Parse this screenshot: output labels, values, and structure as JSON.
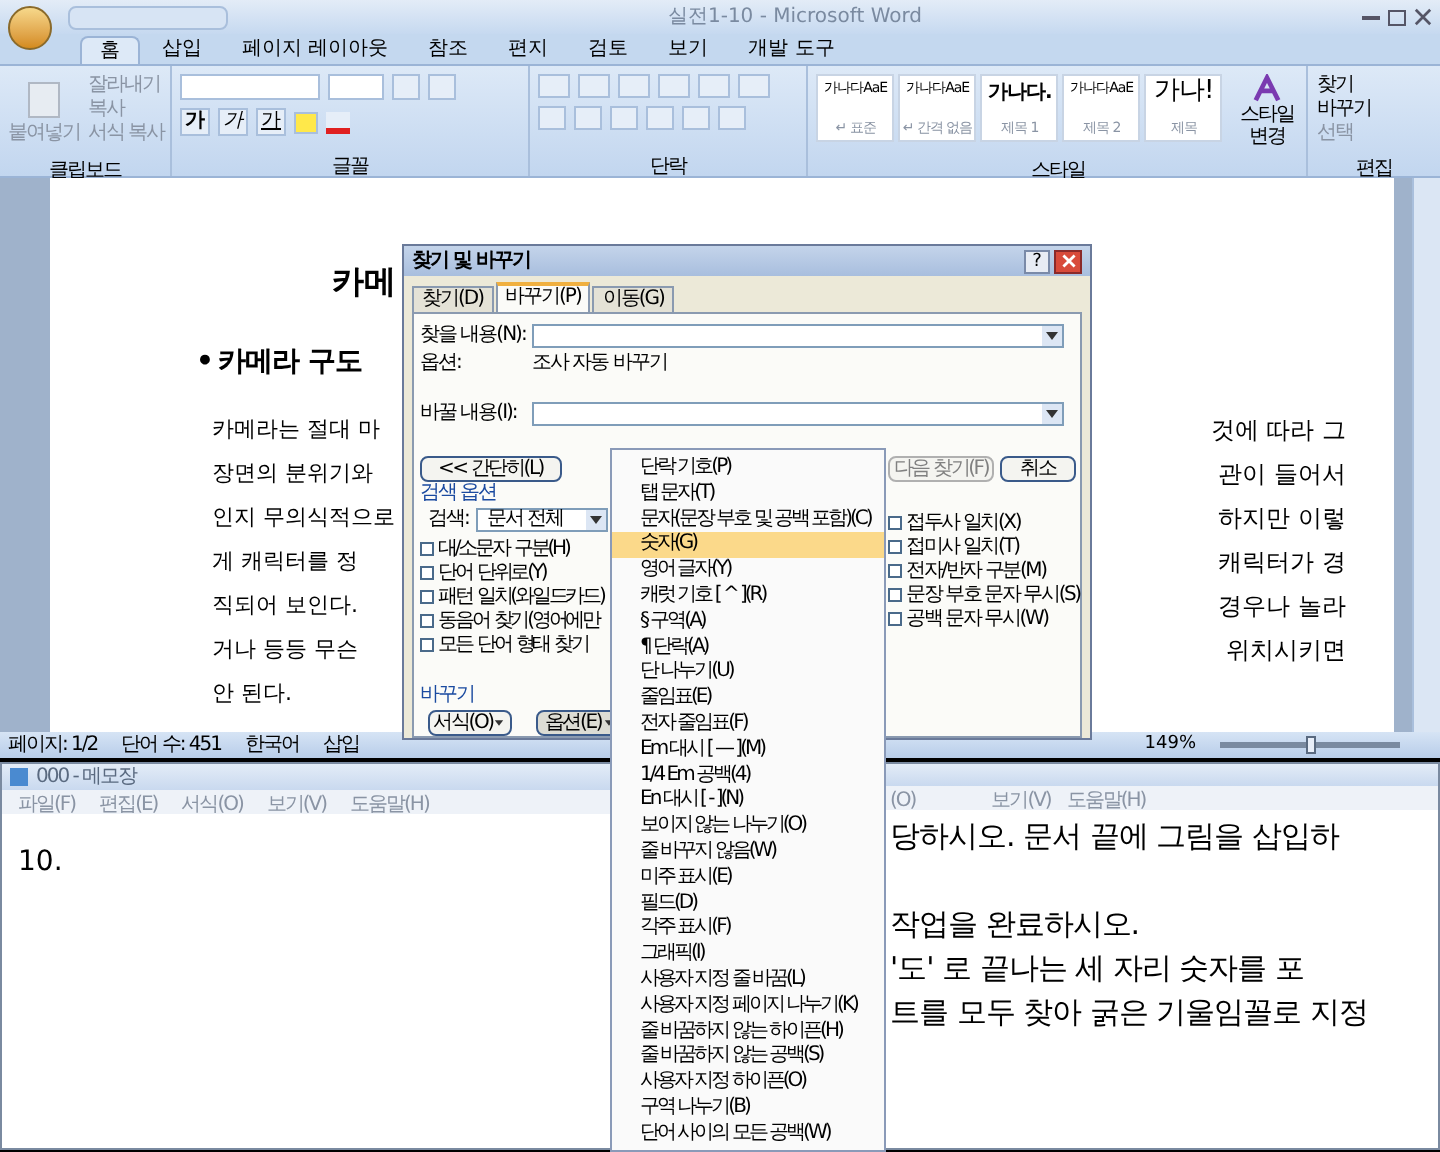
{
  "word": {
    "title": "실전1-10 - Microsoft Word",
    "tabs": [
      {
        "label": "홈",
        "selected": true
      },
      {
        "label": "삽입",
        "selected": false
      },
      {
        "label": "페이지 레이아웃",
        "selected": false
      },
      {
        "label": "참조",
        "selected": false
      },
      {
        "label": "편지",
        "selected": false
      },
      {
        "label": "검토",
        "selected": false
      },
      {
        "label": "보기",
        "selected": false
      },
      {
        "label": "개발 도구",
        "selected": false
      }
    ],
    "ribbon": {
      "clipboard": {
        "label": "클립보드",
        "paste": "붙여넣기",
        "items": [
          "잘라내기",
          "복사",
          "서식 복사"
        ]
      },
      "font": {
        "label": "글꼴",
        "format_buttons": [
          "가",
          "가",
          "가"
        ]
      },
      "paragraph": {
        "label": "단락"
      },
      "styles": {
        "label": "스타일",
        "tiles": [
          {
            "sample": "가나다AaE",
            "name": "↵ 표준",
            "kind": "body"
          },
          {
            "sample": "가나다AaE",
            "name": "↵ 간격 없음",
            "kind": "body"
          },
          {
            "sample": "가나다.",
            "name": "제목 1",
            "kind": "heading"
          },
          {
            "sample": "가나다AaE",
            "name": "제목 2",
            "kind": "body"
          },
          {
            "sample": "가나!",
            "name": "제목",
            "kind": "title"
          }
        ],
        "change": "스타일 변경"
      },
      "editing": {
        "label": "편집",
        "items": [
          "찾기",
          "바꾸기",
          "선택"
        ]
      }
    },
    "document": {
      "title": "카메",
      "bullet": "•",
      "heading": "카메라 구도",
      "lines": [
        {
          "left": "카메라는 절대 마",
          "right": "것에 따라 그"
        },
        {
          "left": "장면의 분위기와",
          "right": "관이 들어서"
        },
        {
          "left": "인지 무의식적으로",
          "right": "하지만 이렇"
        },
        {
          "left": "게 캐릭터를 정",
          "right": "캐릭터가 경"
        },
        {
          "left": "직되어 보인다.",
          "right": "경우나 놀라"
        },
        {
          "left": "거나 등등 무슨",
          "right": "위치시키면"
        },
        {
          "left": "안 된다."
        }
      ]
    },
    "status_bar": {
      "page": "페이지: 1/2",
      "words": "단어 수: 451",
      "language": "한국어",
      "mode": "삽입",
      "zoom": "149%",
      "zoom_slider": {
        "level": 0.5
      }
    }
  },
  "dialog": {
    "title": "찾기 및 바꾸기",
    "help": "?",
    "tabs": [
      {
        "label": "찾기(D)",
        "selected": false
      },
      {
        "label": "바꾸기(P)",
        "selected": true
      },
      {
        "label": "이동(G)",
        "selected": false
      }
    ],
    "find_label": "찾을 내용(N):",
    "options_label": "옵션:",
    "options_value": "조사 자동 바꾸기",
    "replace_label": "바꿀 내용(I):",
    "less_button": "<< 간단히(L)",
    "find_next": "다음 찾기(F)",
    "cancel": "취소",
    "search_options": "검색 옵션",
    "search_label": "검색:",
    "search_value": "문서 전체",
    "left_checks": [
      {
        "label": "대/소문자 구분(H)",
        "checked": false
      },
      {
        "label": "단어 단위로(Y)",
        "checked": false
      },
      {
        "label": "패턴 일치(와일드카드)",
        "checked": false
      },
      {
        "label": "동음어 찾기(영어에만",
        "checked": false
      },
      {
        "label": "모든 단어 형태 찾기",
        "checked": false
      }
    ],
    "right_checks": [
      {
        "label": "접두사 일치(X)",
        "checked": false
      },
      {
        "label": "접미사 일치(T)",
        "checked": false
      },
      {
        "label": "전자/반자 구분(M)",
        "checked": false
      },
      {
        "label": "문장 부호 문자 무시(S)",
        "checked": false
      },
      {
        "label": "공백 문자 무시(W)",
        "checked": false
      }
    ],
    "replace_section": "바꾸기",
    "format_button": "서식(O)",
    "special_button": "옵션(E)"
  },
  "menu": {
    "items": [
      {
        "label": "단락 기호(P)",
        "selected": false
      },
      {
        "label": "탭 문자(T)",
        "selected": false
      },
      {
        "label": "문자(문장 부호 및 공백 포함)(C)",
        "selected": false
      },
      {
        "label": "숫자(G)",
        "selected": true
      },
      {
        "label": "영어 글자(Y)",
        "selected": false
      },
      {
        "label": "캐럿 기호 [ ^ ](R)",
        "selected": false
      },
      {
        "label": "§ 구역(A)",
        "selected": false
      },
      {
        "label": "¶ 단락(A)",
        "selected": false
      },
      {
        "label": "단 나누기(U)",
        "selected": false
      },
      {
        "label": "줄임표(E)",
        "selected": false
      },
      {
        "label": "전자 줄임표(F)",
        "selected": false
      },
      {
        "label": "Em 대시 [ — ](M)",
        "selected": false
      },
      {
        "label": "1/4 Em 공백(4)",
        "selected": false
      },
      {
        "label": "En 대시 [ - ](N)",
        "selected": false
      },
      {
        "label": "보이지 않는 나누기(O)",
        "selected": false
      },
      {
        "label": "줄 바꾸지 않음(W)",
        "selected": false
      },
      {
        "label": "미주 표시(E)",
        "selected": false
      },
      {
        "label": "필드(D)",
        "selected": false
      },
      {
        "label": "각주 표시(F)",
        "selected": false
      },
      {
        "label": "그래픽(I)",
        "selected": false
      },
      {
        "label": "사용자 지정 줄 바꿈(L)",
        "selected": false
      },
      {
        "label": "사용자 지정 페이지 나누기(K)",
        "selected": false
      },
      {
        "label": "줄 바꿈하지 않는 하이픈(H)",
        "selected": false
      },
      {
        "label": "줄 바꿈하지 않는 공백(S)",
        "selected": false
      },
      {
        "label": "사용자 지정 하이픈(O)",
        "selected": false
      },
      {
        "label": "구역 나누기(B)",
        "selected": false
      },
      {
        "label": "단어 사이의 모든 공백(W)",
        "selected": false
      }
    ]
  },
  "notepad": {
    "title": "000 - 메모장",
    "menu": [
      "파일(F)",
      "편집(E)",
      "서식(O)",
      "보기(V)",
      "도움말(H)"
    ],
    "text": "10."
  },
  "notepad_2": {
    "menu": [
      "(O)",
      "보기(V)",
      "도움말(H)"
    ],
    "lines": [
      "당하시오. 문서 끝에 그림을 삽입하",
      "작업을 완료하시오.",
      "'도' 로 끝나는 세 자리 숫자를 포",
      "트를 모두 찾아 굵은 기울임꼴로 지정"
    ]
  }
}
